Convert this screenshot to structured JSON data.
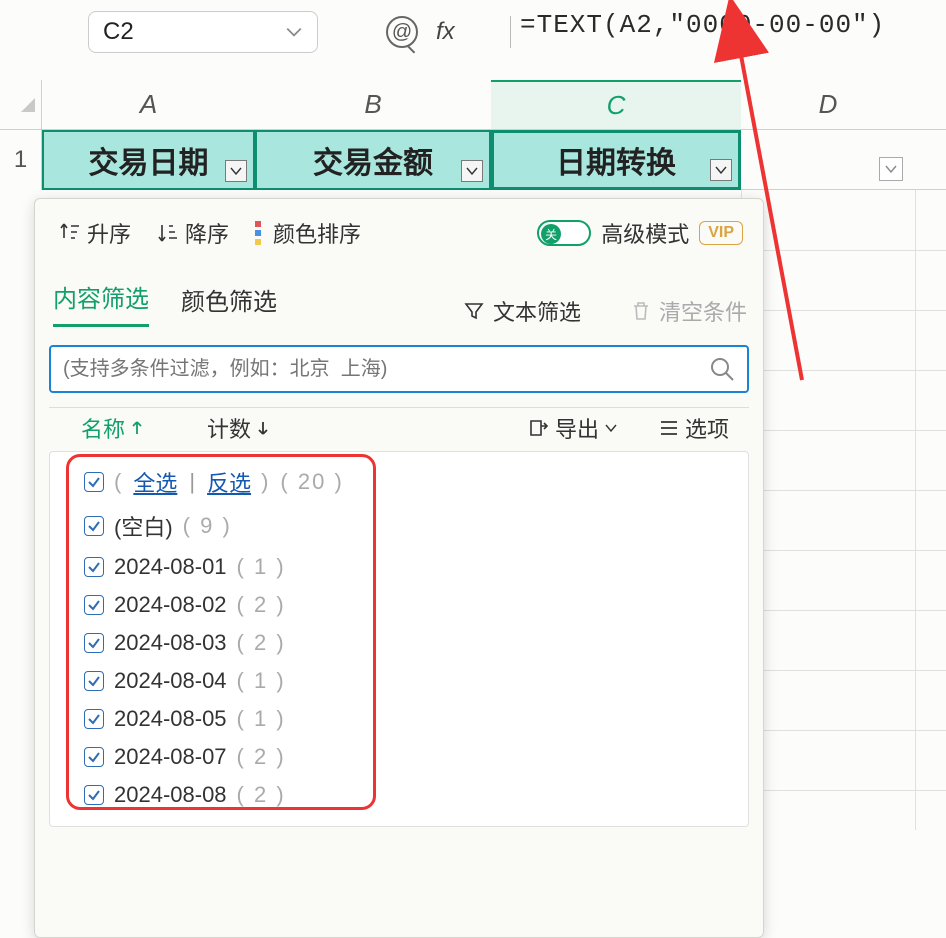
{
  "formula_bar": {
    "cell_ref": "C2",
    "fx_label": "fx",
    "formula": "=TEXT(A2,\"0000-00-00\")"
  },
  "columns": {
    "A": "A",
    "B": "B",
    "C": "C",
    "D": "D"
  },
  "row_labels": {
    "r1": "1"
  },
  "headers": {
    "A": "交易日期",
    "B": "交易金额",
    "C": "日期转换"
  },
  "filter": {
    "sort_asc": "升序",
    "sort_desc": "降序",
    "sort_color": "颜色排序",
    "toggle_off": "关",
    "advanced": "高级模式",
    "vip": "VIP",
    "tab_content": "内容筛选",
    "tab_color": "颜色筛选",
    "text_filter": "文本筛选",
    "clear": "清空条件",
    "search_placeholder": "(支持多条件过滤，例如：北京  上海)",
    "col_name": "名称",
    "col_count": "计数",
    "export": "导出",
    "options": "选项",
    "select_all": "全选",
    "invert": "反选",
    "all_count": "20",
    "blank_label": "(空白)",
    "blank_count": "9",
    "items": [
      {
        "label": "2024-08-01",
        "count": "1"
      },
      {
        "label": "2024-08-02",
        "count": "2"
      },
      {
        "label": "2024-08-03",
        "count": "2"
      },
      {
        "label": "2024-08-04",
        "count": "1"
      },
      {
        "label": "2024-08-05",
        "count": "1"
      },
      {
        "label": "2024-08-07",
        "count": "2"
      },
      {
        "label": "2024-08-08",
        "count": "2"
      }
    ]
  }
}
